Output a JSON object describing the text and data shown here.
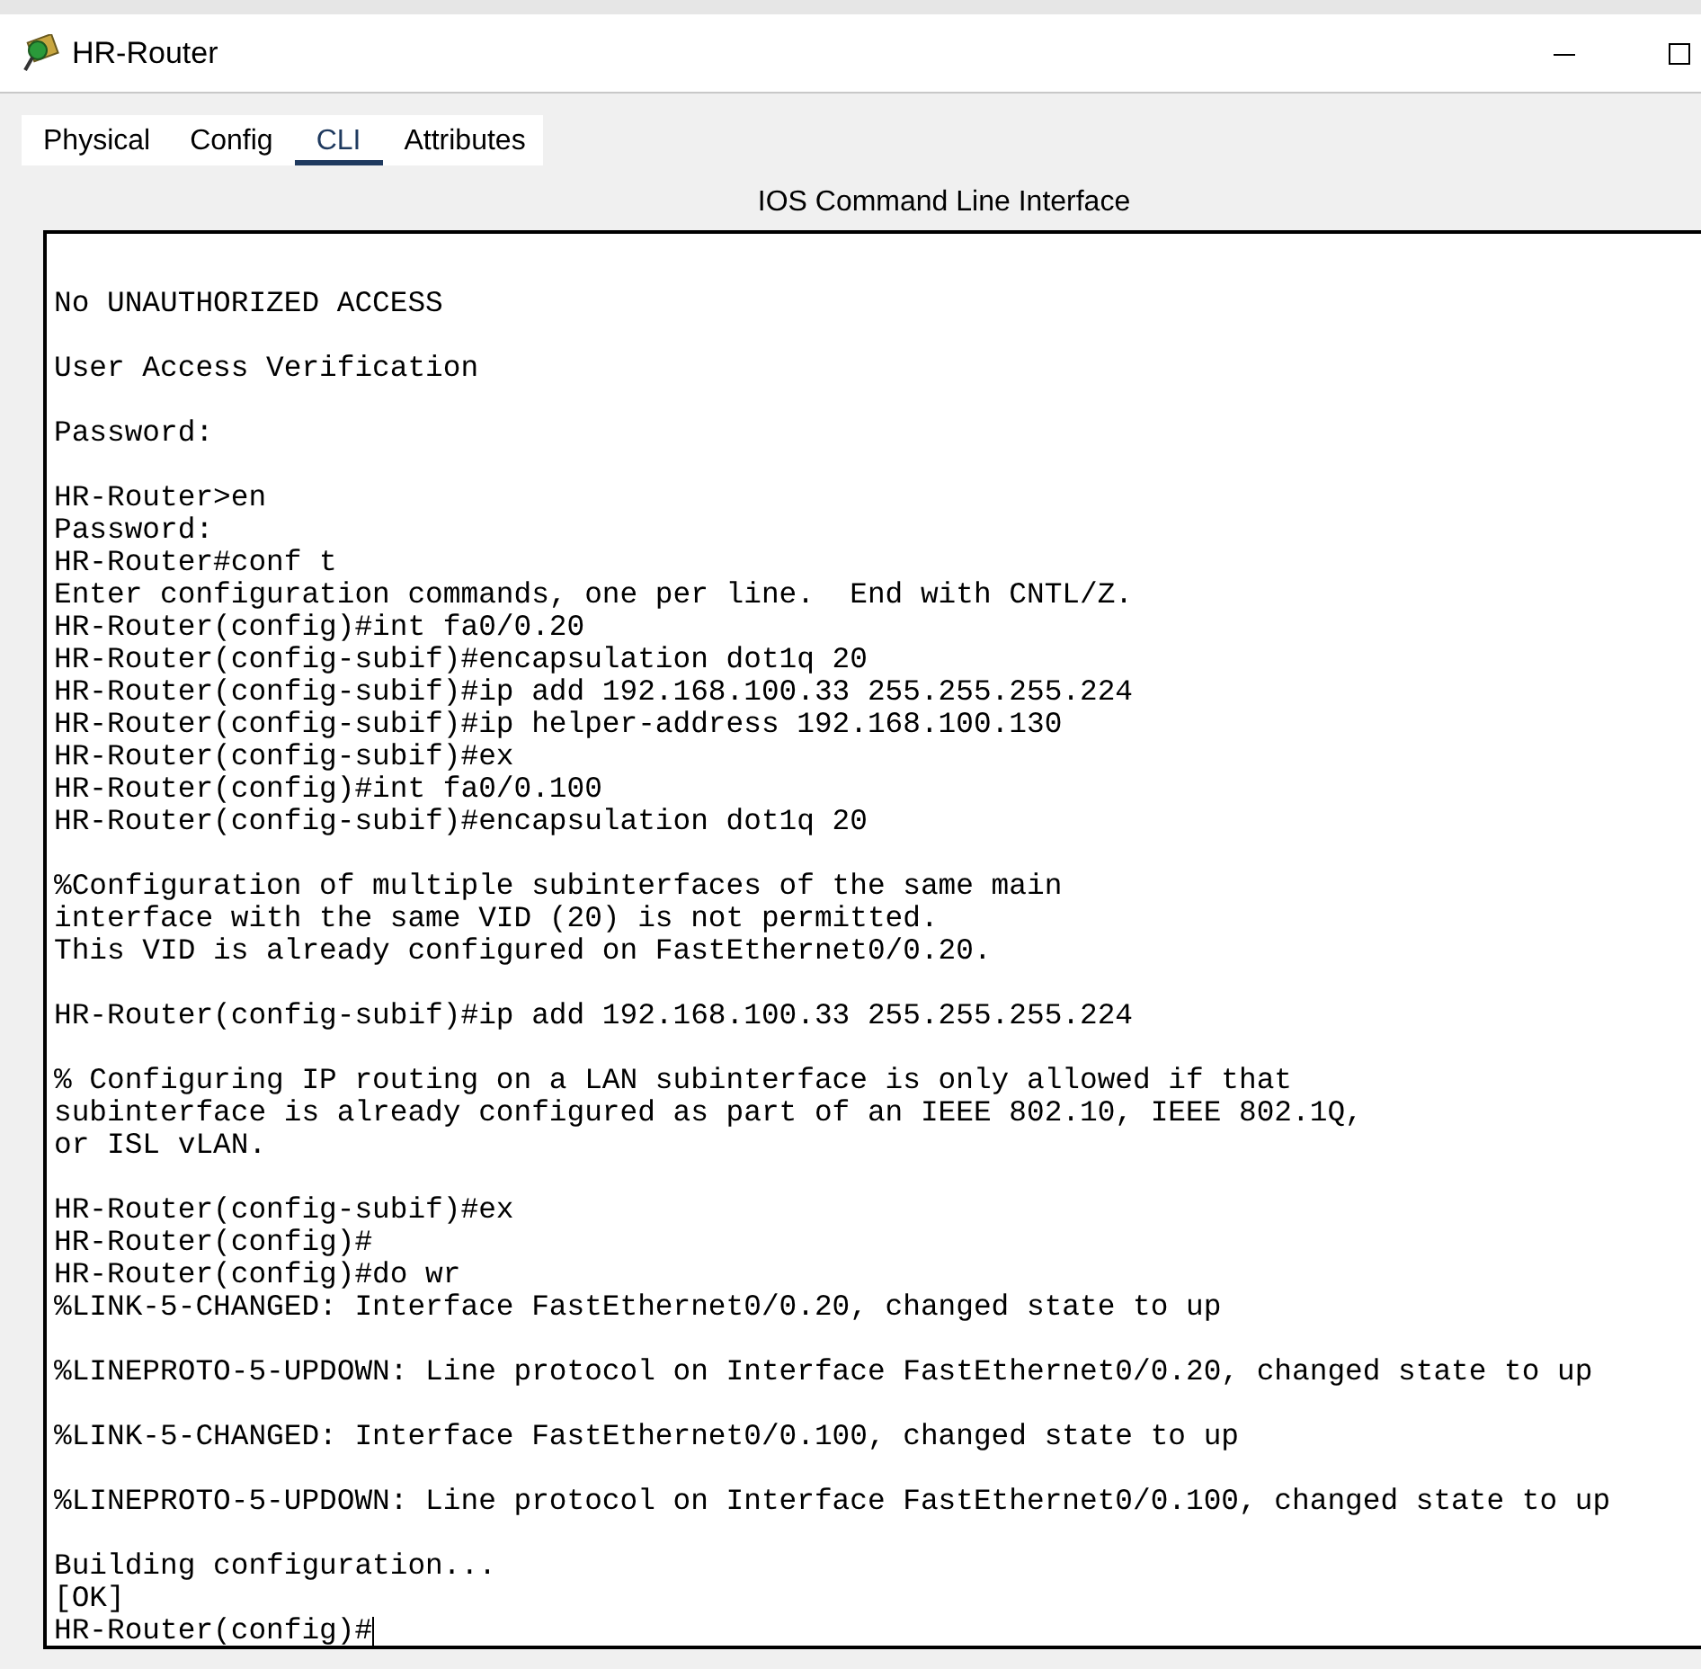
{
  "window": {
    "title": "HR-Router"
  },
  "tabs": [
    {
      "label": "Physical",
      "selected": false
    },
    {
      "label": "Config",
      "selected": false
    },
    {
      "label": "CLI",
      "selected": true
    },
    {
      "label": "Attributes",
      "selected": false
    }
  ],
  "panel_title": "IOS Command Line Interface",
  "terminal": {
    "cursor": true,
    "text": "No UNAUTHORIZED ACCESS\n\nUser Access Verification\n\nPassword:\n\nHR-Router>en\nPassword:\nHR-Router#conf t\nEnter configuration commands, one per line.  End with CNTL/Z.\nHR-Router(config)#int fa0/0.20\nHR-Router(config-subif)#encapsulation dot1q 20\nHR-Router(config-subif)#ip add 192.168.100.33 255.255.255.224\nHR-Router(config-subif)#ip helper-address 192.168.100.130\nHR-Router(config-subif)#ex\nHR-Router(config)#int fa0/0.100\nHR-Router(config-subif)#encapsulation dot1q 20\n\n%Configuration of multiple subinterfaces of the same main\ninterface with the same VID (20) is not permitted.\nThis VID is already configured on FastEthernet0/0.20.\n\nHR-Router(config-subif)#ip add 192.168.100.33 255.255.255.224\n\n% Configuring IP routing on a LAN subinterface is only allowed if that\nsubinterface is already configured as part of an IEEE 802.10, IEEE 802.1Q,\nor ISL vLAN.\n\nHR-Router(config-subif)#ex\nHR-Router(config)#\nHR-Router(config)#do wr\n%LINK-5-CHANGED: Interface FastEthernet0/0.20, changed state to up\n\n%LINEPROTO-5-UPDOWN: Line protocol on Interface FastEthernet0/0.20, changed state to up\n\n%LINK-5-CHANGED: Interface FastEthernet0/0.100, changed state to up\n\n%LINEPROTO-5-UPDOWN: Line protocol on Interface FastEthernet0/0.100, changed state to up\n\nBuilding configuration...\n[OK]\nHR-Router(config)#"
  }
}
